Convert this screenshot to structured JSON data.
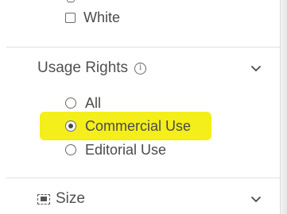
{
  "color_filter": {
    "option_label": "White",
    "checked": false
  },
  "usage_rights": {
    "title": "Usage Rights",
    "info_icon": "info-icon",
    "expand_icon": "chevron-down-icon",
    "selected": "Commercial Use",
    "highlight_color": "#f4ee1a",
    "options": [
      {
        "label": "All",
        "checked": false
      },
      {
        "label": "Commercial Use",
        "checked": true
      },
      {
        "label": "Editorial Use",
        "checked": false
      }
    ]
  },
  "size": {
    "title": "Size",
    "icon": "size-icon",
    "expand_icon": "chevron-down-icon"
  }
}
